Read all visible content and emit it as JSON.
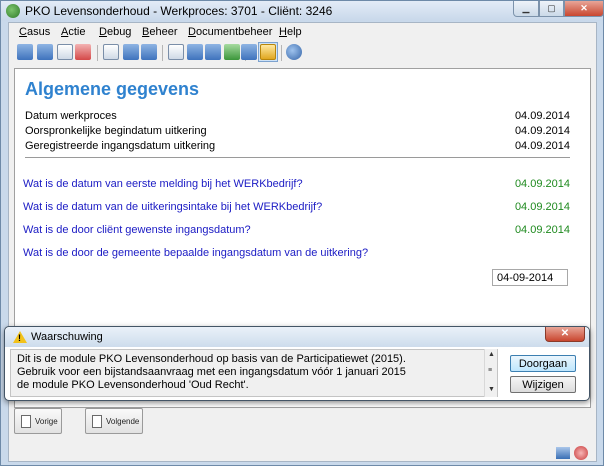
{
  "window": {
    "title": "PKO Levensonderhoud - Werkproces: 3701 - Cliënt: 3246"
  },
  "menu": [
    "Casus",
    "Actie",
    "Debug",
    "Beheer",
    "Documentbeheer",
    "Help"
  ],
  "toolbar": {
    "icons": [
      "first-record-icon",
      "last-record-icon",
      "list-icon",
      "edit-icon",
      "grid-icon",
      "sort-icon",
      "sort-desc-icon",
      "document-icon",
      "list-view-icon",
      "table-icon",
      "refresh-icon",
      "flow-icon",
      "return-icon",
      "notes-icon",
      "globe-icon"
    ]
  },
  "main": {
    "heading": "Algemene gegevens",
    "info": [
      {
        "label": "Datum werkproces",
        "value": "04.09.2014"
      },
      {
        "label": "Oorspronkelijke begindatum uitkering",
        "value": "04.09.2014"
      },
      {
        "label": "Geregistreerde ingangsdatum uitkering",
        "value": "04.09.2014"
      }
    ],
    "questions": [
      {
        "label": "Wat is de datum van eerste melding bij het WERKbedrijf?",
        "answer": "04.09.2014"
      },
      {
        "label": "Wat is de datum van de uitkeringsintake bij het WERKbedrijf?",
        "answer": "04.09.2014"
      },
      {
        "label": "Wat is de door cliënt gewenste ingangsdatum?",
        "answer": "04.09.2014"
      },
      {
        "label": "Wat is de door de gemeente bepaalde ingangsdatum van de uitkering?",
        "input_value": "04-09-2014"
      }
    ],
    "accent": "#2f82cf",
    "question_color": "#1b1bc4",
    "answer_color": "#1f8a1f"
  },
  "nav": {
    "prev_label": "Vorige",
    "next_label": "Volgende"
  },
  "dialog": {
    "title": "Waarschuwing",
    "close_label": "✕",
    "lines": [
      "Dit is de module PKO Levensonderhoud op basis van de Participatiewet (2015).",
      "Gebruik voor een bijstandsaanvraag met een ingangsdatum vóór 1 januari 2015",
      "de module PKO Levensonderhoud 'Oud Recht'."
    ],
    "primary_button": "Doorgaan",
    "secondary_button": "Wijzigen"
  }
}
